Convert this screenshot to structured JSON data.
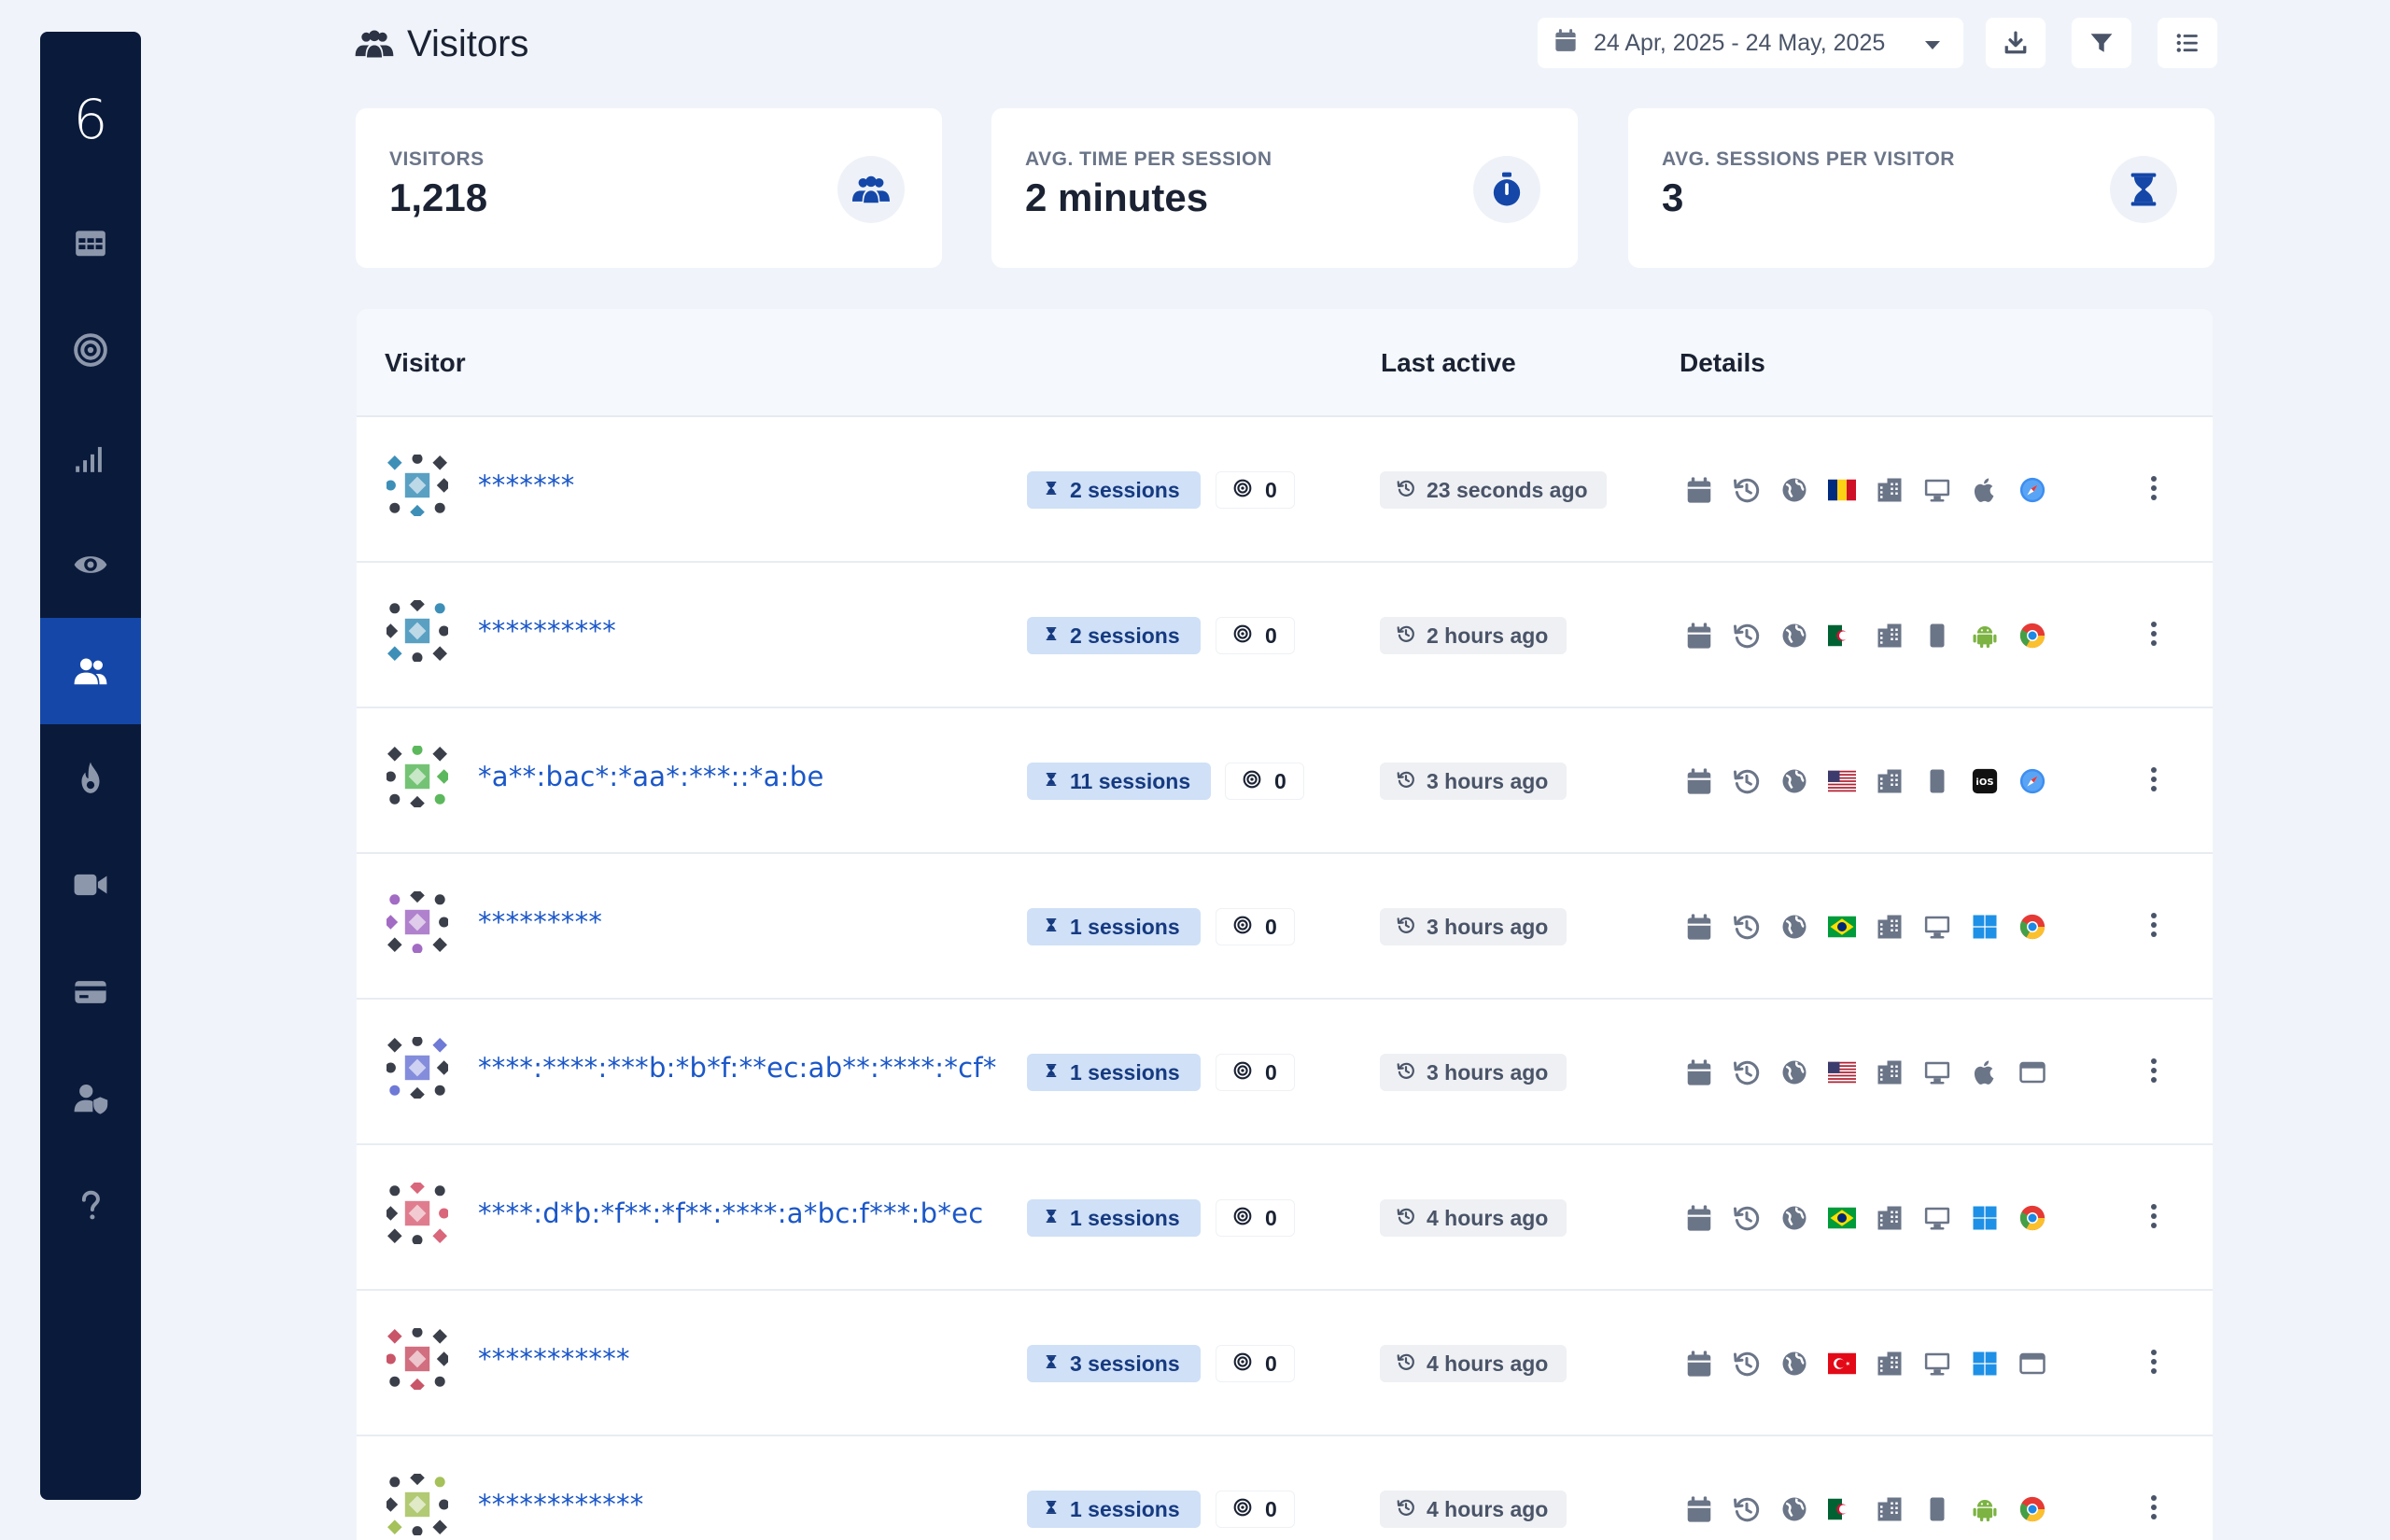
{
  "app": {
    "logo": "6"
  },
  "sidebar": {
    "items": [
      {
        "name": "dashboard-grid"
      },
      {
        "name": "goals"
      },
      {
        "name": "analytics"
      },
      {
        "name": "pageviews"
      },
      {
        "name": "visitors",
        "active": true
      },
      {
        "name": "heatmaps"
      },
      {
        "name": "recordings"
      },
      {
        "name": "billing"
      },
      {
        "name": "admin"
      },
      {
        "name": "help"
      }
    ],
    "colors": {
      "bg": "#0a1a3b",
      "active": "#1447a8"
    }
  },
  "header": {
    "title": "Visitors",
    "date_range": "24 Apr, 2025 - 24 May, 2025"
  },
  "stats": {
    "visitors": {
      "label": "VISITORS",
      "value": "1,218"
    },
    "avg_time": {
      "label": "AVG. TIME PER SESSION",
      "value": "2 minutes"
    },
    "avg_sessions": {
      "label": "AVG. SESSIONS PER VISITOR",
      "value": "3"
    }
  },
  "table": {
    "columns": {
      "visitor": "Visitor",
      "last_active": "Last active",
      "details": "Details"
    },
    "rows": [
      {
        "name": "*******",
        "sessions": "2 sessions",
        "goals": "0",
        "last_active": "23 seconds ago",
        "flag": "ro",
        "device": "desktop",
        "os": "apple",
        "browser": "safari"
      },
      {
        "name": "**********",
        "sessions": "2 sessions",
        "goals": "0",
        "last_active": "2 hours ago",
        "flag": "dz",
        "device": "mobile",
        "os": "android",
        "browser": "chrome"
      },
      {
        "name": "*a**:bac*:*aa*:***::*a:be",
        "sessions": "11 sessions",
        "goals": "0",
        "last_active": "3 hours ago",
        "flag": "us",
        "device": "mobile",
        "os": "ios",
        "browser": "safari"
      },
      {
        "name": "*********",
        "sessions": "1 sessions",
        "goals": "0",
        "last_active": "3 hours ago",
        "flag": "br",
        "device": "desktop",
        "os": "windows",
        "browser": "chrome"
      },
      {
        "name": "****:****:***b:*b*f:**ec:ab**:****:*cf*",
        "sessions": "1 sessions",
        "goals": "0",
        "last_active": "3 hours ago",
        "flag": "us",
        "device": "desktop",
        "os": "apple",
        "browser": "window"
      },
      {
        "name": "****:d*b:*f**:*f**:****:a*bc:f***:b*ec",
        "sessions": "1 sessions",
        "goals": "0",
        "last_active": "4 hours ago",
        "flag": "br",
        "device": "desktop",
        "os": "windows",
        "browser": "chrome"
      },
      {
        "name": "***********",
        "sessions": "3 sessions",
        "goals": "0",
        "last_active": "4 hours ago",
        "flag": "tr",
        "device": "desktop",
        "os": "windows",
        "browser": "window"
      },
      {
        "name": "************",
        "sessions": "1 sessions",
        "goals": "0",
        "last_active": "4 hours ago",
        "flag": "dz",
        "device": "mobile",
        "os": "android",
        "browser": "chrome"
      }
    ]
  },
  "theme": {
    "accent": "#1447a8",
    "link": "#1b57c8",
    "badge_bg": "#cfe0f7",
    "page_bg": "#f0f4fa"
  }
}
